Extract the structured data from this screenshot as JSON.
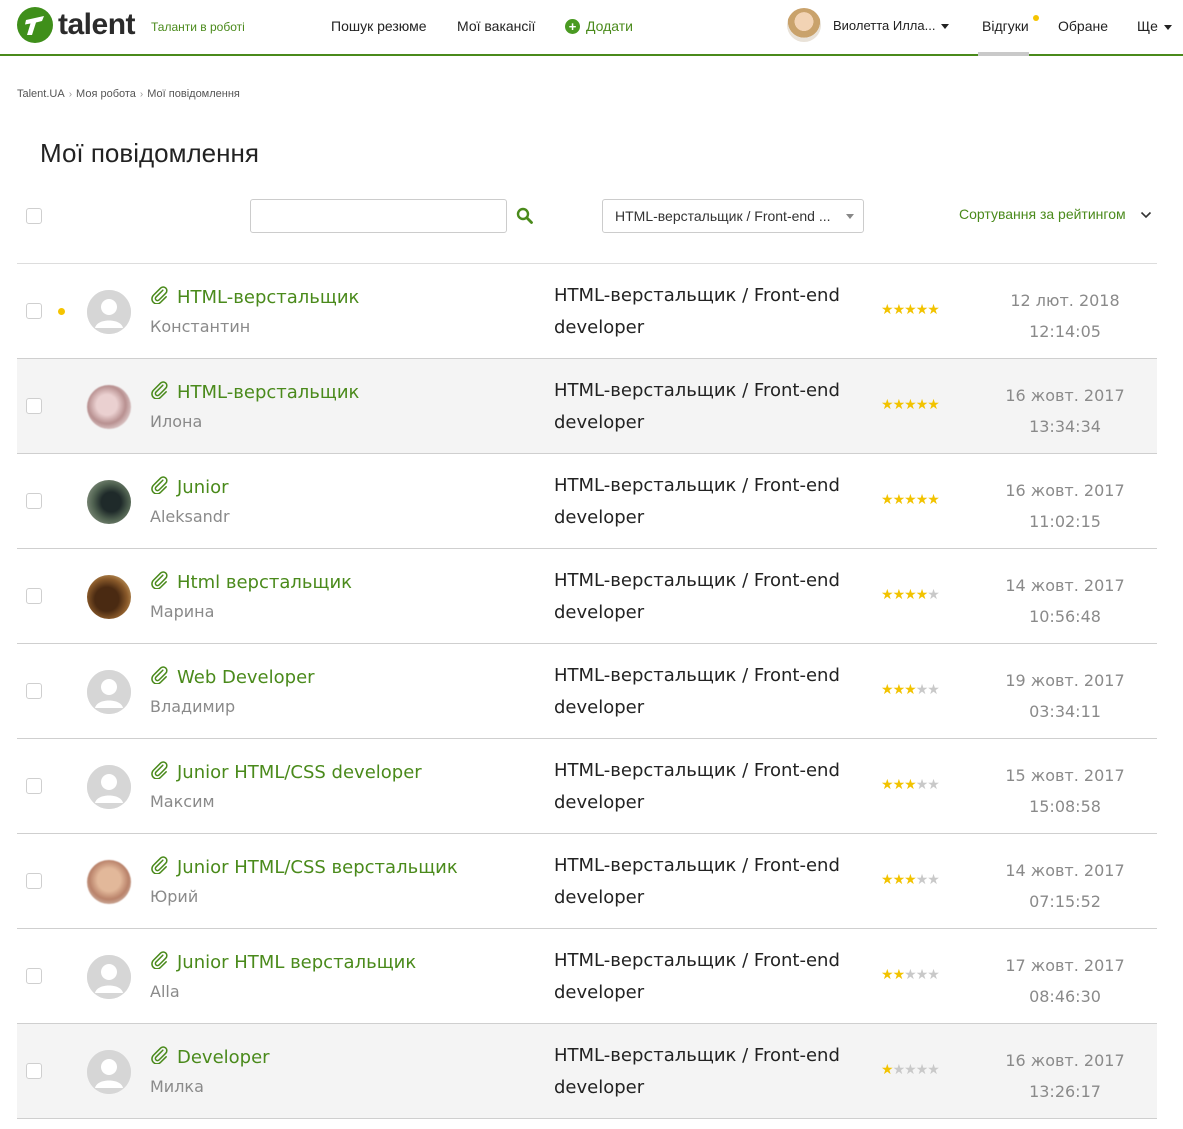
{
  "header": {
    "logo_text": "talent",
    "tagline": "Таланти в роботі",
    "nav": {
      "search_resumes": "Пошук резюме",
      "my_vacancies": "Мої вакансії",
      "add": "Додати"
    },
    "user_name": "Виолетта Илла...",
    "responses": "Відгуки",
    "favorites": "Обране",
    "more": "Ще",
    "accent_color": "#4a8a1b"
  },
  "breadcrumb": [
    "Talent.UA",
    "Моя робота",
    "Мої повідомлення"
  ],
  "page_title": "Мої повідомлення",
  "toolbar": {
    "search_placeholder": "",
    "vacancy_filter": "HTML-верстальщик / Front-end ...",
    "sort_label": "Сортування за рейтингом"
  },
  "messages": [
    {
      "title": "HTML-верстальщик",
      "name": "Константин",
      "vacancy": "HTML-верстальщик / Front-end developer",
      "rating": 5,
      "date": "12 лют. 2018",
      "time": "12:14:05",
      "unread": true,
      "avatar": "placeholder"
    },
    {
      "title": "HTML-верстальщик",
      "name": "Илона",
      "vacancy": "HTML-верстальщик / Front-end developer",
      "rating": 5,
      "date": "16 жовт. 2017",
      "time": "13:34:34",
      "unread": false,
      "avatar": "photo"
    },
    {
      "title": "Junior",
      "name": "Aleksandr",
      "vacancy": "HTML-верстальщик / Front-end developer",
      "rating": 5,
      "date": "16 жовт. 2017",
      "time": "11:02:15",
      "unread": false,
      "avatar": "photo"
    },
    {
      "title": "Html верстальщик",
      "name": "Марина",
      "vacancy": "HTML-верстальщик / Front-end developer",
      "rating": 4,
      "date": "14 жовт. 2017",
      "time": "10:56:48",
      "unread": false,
      "avatar": "photo"
    },
    {
      "title": "Web Developer",
      "name": "Владимир",
      "vacancy": "HTML-верстальщик / Front-end developer",
      "rating": 3,
      "date": "19 жовт. 2017",
      "time": "03:34:11",
      "unread": false,
      "avatar": "placeholder"
    },
    {
      "title": "Junior HTML/CSS developer",
      "name": "Максим",
      "vacancy": "HTML-верстальщик / Front-end developer",
      "rating": 3,
      "date": "15 жовт. 2017",
      "time": "15:08:58",
      "unread": false,
      "avatar": "placeholder"
    },
    {
      "title": "Junior HTML/CSS верстальщик",
      "name": "Юрий",
      "vacancy": "HTML-верстальщик / Front-end developer",
      "rating": 3,
      "date": "14 жовт. 2017",
      "time": "07:15:52",
      "unread": false,
      "avatar": "photo"
    },
    {
      "title": "Junior HTML верстальщик",
      "name": "Alla",
      "vacancy": "HTML-верстальщик / Front-end developer",
      "rating": 2,
      "date": "17 жовт. 2017",
      "time": "08:46:30",
      "unread": false,
      "avatar": "placeholder"
    },
    {
      "title": "Developer",
      "name": "Милка",
      "vacancy": "HTML-верстальщик / Front-end developer",
      "rating": 1,
      "date": "16 жовт. 2017",
      "time": "13:26:17",
      "unread": false,
      "avatar": "placeholder"
    }
  ]
}
